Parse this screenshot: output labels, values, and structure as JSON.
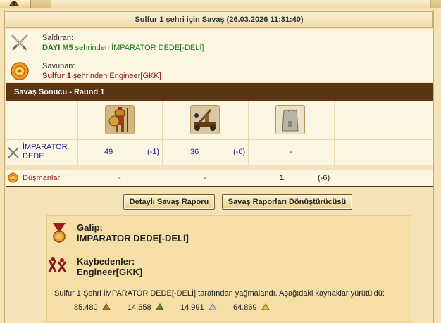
{
  "title": "Sulfur 1 şehri için Savaş (26.03.2026 11:31:40)",
  "attacker": {
    "role": "Saldıran:",
    "player": "DAYI M5",
    "line_rest": " şehrinden İMPARATOR DEDE[-DELİ]"
  },
  "defender": {
    "role": "Savunan:",
    "city": "Sulfur 1",
    "line_rest": " şehrinden Engineer[GKK]"
  },
  "round": {
    "title": "Savaş Sonucu - Raund 1"
  },
  "units": [
    "hoplite-icon",
    "catapult-icon",
    "wall-icon"
  ],
  "rows": [
    {
      "name": "İMPARATOR DEDE",
      "icon": "crossed-swords-icon",
      "cells": [
        {
          "value": "49",
          "loss": "(-1)"
        },
        {
          "value": "36",
          "loss": "(-0)"
        },
        {
          "value": "-",
          "loss": ""
        }
      ]
    },
    {
      "name": "Düşmanlar",
      "icon": "shield-icon",
      "cells": [
        {
          "value": "-",
          "loss": ""
        },
        {
          "value": "-",
          "loss": ""
        },
        {
          "value": "1",
          "loss": "(-6)"
        }
      ]
    }
  ],
  "buttons": {
    "detail": "Detaylı Savaş Raporu",
    "converter": "Savaş Raporları Dönüştürücüsü"
  },
  "result": {
    "winner_label": "Galip:",
    "winner_name": "İMPARATOR DEDE[-DELİ]",
    "losers_label": "Kaybedenler:",
    "losers_name": "Engineer[GKK]",
    "loot_text": "Sulfur 1 Şehri İMPARATOR DEDE[-DELİ] tarafından yağmalandı. Aşağıdaki kaynaklar yürütüldü:",
    "resources": [
      {
        "amount": "85.480",
        "icon": "wood-icon"
      },
      {
        "amount": "14.658",
        "icon": "wine-icon"
      },
      {
        "amount": "14.991",
        "icon": "marble-icon"
      },
      {
        "amount": "64.869",
        "icon": "sulfur-icon"
      }
    ]
  },
  "colors": {
    "header_bar": "#5b3411",
    "attacker_text": "#1f7a1f",
    "defender_text": "#8a1b1b",
    "unit_values": "#1a1a9a"
  }
}
